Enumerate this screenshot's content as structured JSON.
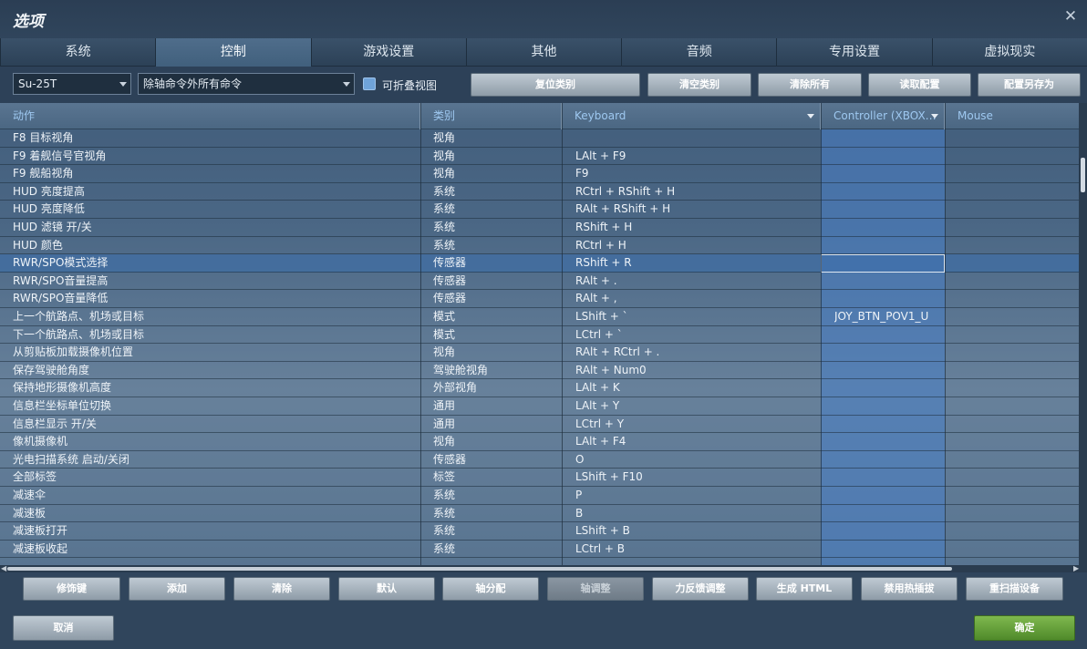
{
  "window": {
    "title": "选项"
  },
  "tabs": [
    "系统",
    "控制",
    "游戏设置",
    "其他",
    "音频",
    "专用设置",
    "虚拟现实"
  ],
  "toolbar": {
    "aircraft": "Su-25T",
    "filter": "除轴命令外所有命令",
    "collapsible_label": "可折叠视图",
    "reset_category": "复位类别",
    "clear_category": "清空类别",
    "clear_all": "清除所有",
    "load_profile": "读取配置",
    "save_profile_as": "配置另存为"
  },
  "columns": {
    "action": "动作",
    "category": "类别",
    "keyboard": "Keyboard",
    "controller": "Controller (XBOX…",
    "mouse": "Mouse"
  },
  "rows": [
    {
      "action": "F8 目标视角",
      "category": "视角",
      "keyboard": "",
      "controller": ""
    },
    {
      "action": "F9 着舰信号官视角",
      "category": "视角",
      "keyboard": "LAlt + F9",
      "controller": ""
    },
    {
      "action": "F9 舰船视角",
      "category": "视角",
      "keyboard": "F9",
      "controller": ""
    },
    {
      "action": "HUD 亮度提高",
      "category": "系统",
      "keyboard": "RCtrl + RShift + H",
      "controller": ""
    },
    {
      "action": "HUD 亮度降低",
      "category": "系统",
      "keyboard": "RAlt + RShift + H",
      "controller": ""
    },
    {
      "action": "HUD 滤镜 开/关",
      "category": "系统",
      "keyboard": "RShift + H",
      "controller": ""
    },
    {
      "action": "HUD 颜色",
      "category": "系统",
      "keyboard": "RCtrl + H",
      "controller": ""
    },
    {
      "action": "RWR/SPO模式选择",
      "category": "传感器",
      "keyboard": "RShift + R",
      "controller": "",
      "selected": true
    },
    {
      "action": "RWR/SPO音量提高",
      "category": "传感器",
      "keyboard": "RAlt + .",
      "controller": ""
    },
    {
      "action": "RWR/SPO音量降低",
      "category": "传感器",
      "keyboard": "RAlt + ,",
      "controller": ""
    },
    {
      "action": "上一个航路点、机场或目标",
      "category": "模式",
      "keyboard": "LShift + `",
      "controller": "JOY_BTN_POV1_U"
    },
    {
      "action": "下一个航路点、机场或目标",
      "category": "模式",
      "keyboard": "LCtrl + `",
      "controller": ""
    },
    {
      "action": "从剪贴板加载摄像机位置",
      "category": "视角",
      "keyboard": "RAlt + RCtrl + .",
      "controller": ""
    },
    {
      "action": "保存驾驶舱角度",
      "category": "驾驶舱视角",
      "keyboard": "RAlt + Num0",
      "controller": ""
    },
    {
      "action": "保持地形摄像机高度",
      "category": "外部视角",
      "keyboard": "LAlt + K",
      "controller": ""
    },
    {
      "action": "信息栏坐标单位切换",
      "category": "通用",
      "keyboard": "LAlt + Y",
      "controller": ""
    },
    {
      "action": "信息栏显示 开/关",
      "category": "通用",
      "keyboard": "LCtrl + Y",
      "controller": ""
    },
    {
      "action": "像机摄像机",
      "category": "视角",
      "keyboard": "LAlt + F4",
      "controller": ""
    },
    {
      "action": "光电扫描系统 启动/关闭",
      "category": "传感器",
      "keyboard": "O",
      "controller": ""
    },
    {
      "action": "全部标签",
      "category": "标签",
      "keyboard": "LShift + F10",
      "controller": ""
    },
    {
      "action": "减速伞",
      "category": "系统",
      "keyboard": "P",
      "controller": ""
    },
    {
      "action": "减速板",
      "category": "系统",
      "keyboard": "B",
      "controller": ""
    },
    {
      "action": "减速板打开",
      "category": "系统",
      "keyboard": "LShift + B",
      "controller": ""
    },
    {
      "action": "减速板收起",
      "category": "系统",
      "keyboard": "LCtrl + B",
      "controller": ""
    }
  ],
  "bottom_buttons": [
    "修饰键",
    "添加",
    "清除",
    "默认",
    "轴分配",
    "轴调整",
    "力反馈调整",
    "生成 HTML",
    "禁用热插拔",
    "重扫描设备"
  ],
  "footer": {
    "cancel": "取消",
    "ok": "确定"
  }
}
